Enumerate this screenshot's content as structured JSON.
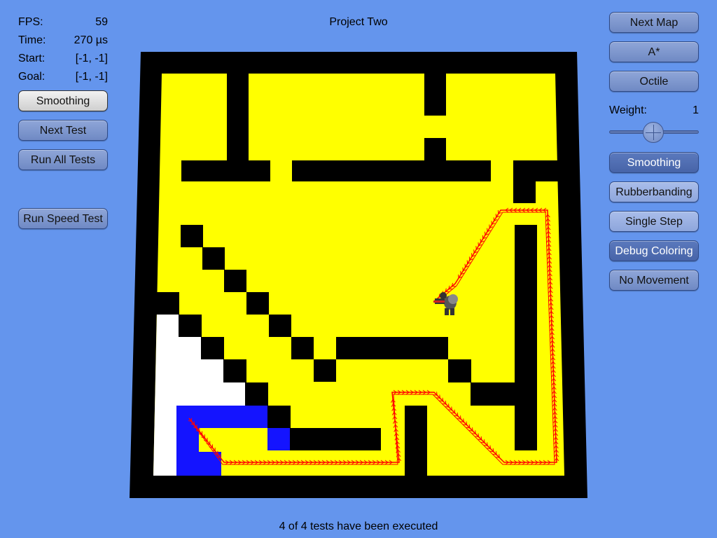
{
  "stats": {
    "fps_label": "FPS:",
    "fps_value": "59",
    "time_label": "Time:",
    "time_value": "270 µs",
    "start_label": "Start:",
    "start_value": "[-1, -1]",
    "goal_label": "Goal:",
    "goal_value": "[-1, -1]"
  },
  "left_buttons": {
    "smoothing": "Smoothing",
    "next_test": "Next Test",
    "run_all_tests": "Run All Tests",
    "run_speed_test": "Run Speed Test"
  },
  "title": "Project Two",
  "status": "4 of 4 tests have been executed",
  "right_panel": {
    "next_map": "Next Map",
    "algorithm": "A*",
    "heuristic": "Octile",
    "weight_label": "Weight:",
    "weight_value": "1",
    "smoothing": "Smoothing",
    "rubberbanding": "Rubberbanding",
    "single_step": "Single Step",
    "debug_coloring": "Debug Coloring",
    "no_movement": "No Movement"
  },
  "colors": {
    "background": "#6495ED",
    "open_cell": "#FFFF00",
    "wall": "#000000",
    "visited": "#FFFFFF",
    "start_region": "#1414FF",
    "path": "#FF0000"
  },
  "agent_icon": "character-icon"
}
